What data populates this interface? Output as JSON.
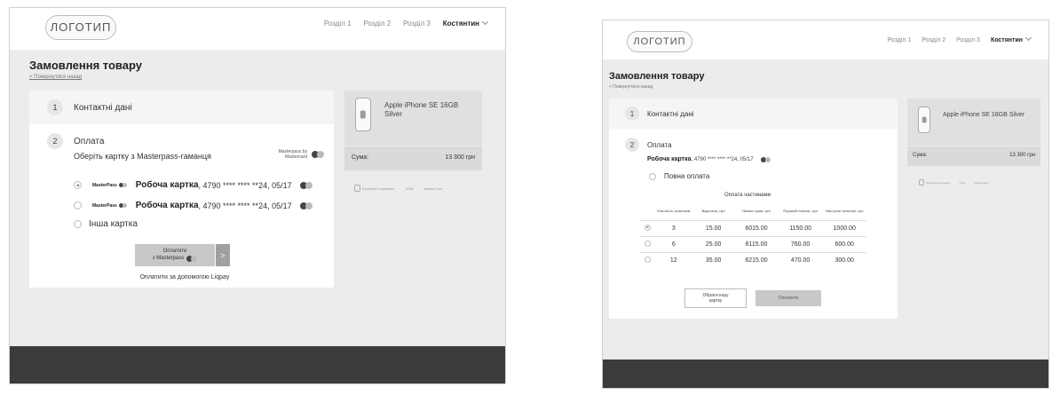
{
  "left": {
    "logo": "ЛОГОТИП",
    "nav": [
      "Розділ 1",
      "Розділ 2",
      "Розділ 3"
    ],
    "user": "Костянтин",
    "title": "Замовлення товару",
    "back": "< Повернутися назад",
    "steps": [
      {
        "num": "1",
        "label": "Контактні дані"
      },
      {
        "num": "2",
        "label": "Оплата"
      }
    ],
    "choose_card": "Оберіть картку з Masterpass-гаманця",
    "masterpass_badge": "Masterpass by Mastercard",
    "cards": [
      {
        "brand": "MasterPass",
        "name": "Робоча картка",
        "details": ", 4790 **** **** **24, 05/17",
        "selected": true
      },
      {
        "brand": "MasterPass",
        "name": "Робоча картка",
        "details": ", 4790 **** **** **24, 05/17",
        "selected": false
      }
    ],
    "other_card": "Інша картка",
    "pay_btn_line1": "Оплатити",
    "pay_btn_line2": "з Masterpass",
    "pay_arrow": ">",
    "liqpay": "Оплатити за допомогою Liqpay",
    "product": "Apple iPhone SE 16GB Silver",
    "sum_label": "Сума:",
    "sum_value": "13 300 грн",
    "badges": [
      "Безпечне з'єднання",
      "VISA",
      "MasterCard"
    ]
  },
  "right": {
    "logo": "ЛОГОТИП",
    "nav": [
      "Розділ 1",
      "Розділ 2",
      "Розділ 3"
    ],
    "user": "Костянтин",
    "title": "Замовлення товару",
    "back": "< Повернутися назад",
    "steps": [
      {
        "num": "1",
        "label": "Контактні дані"
      },
      {
        "num": "2",
        "label": "Оплата"
      }
    ],
    "card_name": "Робоча картка",
    "card_details": ", 4790 **** **** **24, 05/17",
    "full_pay": "Повна оплата",
    "installments_title": "Оплата частинами",
    "table_headers": [
      "Кількість платежів",
      "Відсотки, грн",
      "Повна сума, грн",
      "Перший платіж, грн",
      "Наступні платежі, грн"
    ],
    "table_rows": [
      {
        "selected": true,
        "cells": [
          "3",
          "15.00",
          "6015.00",
          "1150.00",
          "1000.00"
        ]
      },
      {
        "selected": false,
        "cells": [
          "6",
          "25.00",
          "6115.00",
          "760.00",
          "600.00"
        ]
      },
      {
        "selected": false,
        "cells": [
          "12",
          "35.00",
          "6215.00",
          "470.00",
          "300.00"
        ]
      }
    ],
    "other_card_btn": "Обрати іншу картку",
    "pay_btn": "Оплатити",
    "product": "Apple iPhone SE 16GB Silver",
    "sum_label": "Сума:",
    "sum_value": "13 300 грн",
    "badges": [
      "Безпечне з'єднання",
      "VISA",
      "MasterCard"
    ]
  }
}
